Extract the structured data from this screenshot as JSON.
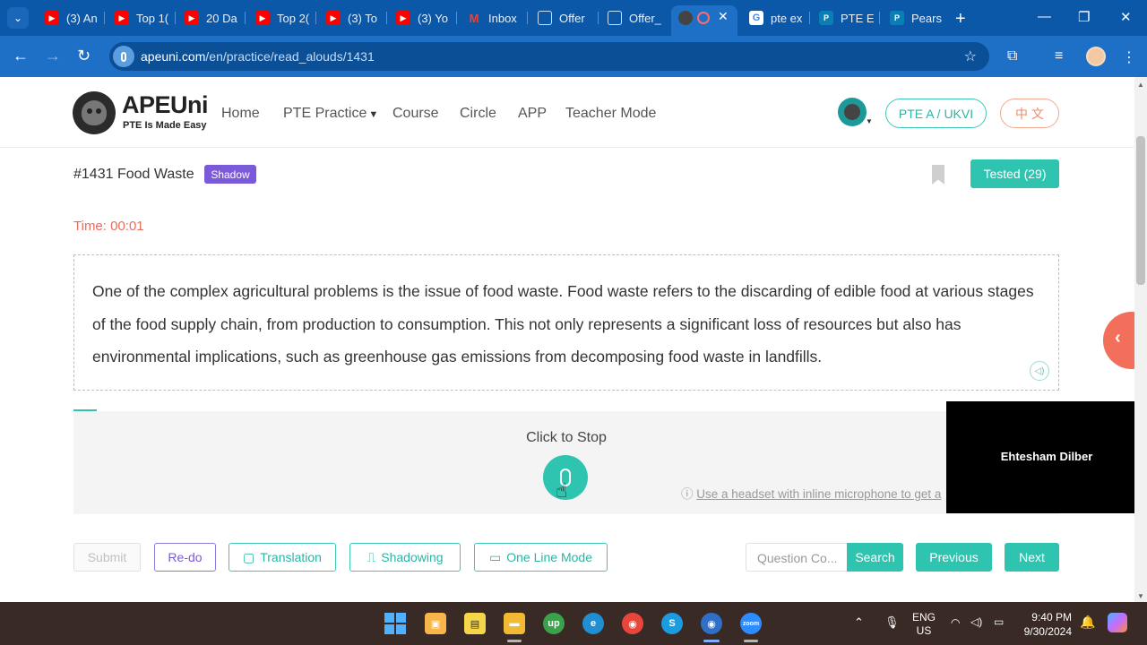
{
  "browser": {
    "tabs": [
      {
        "label": "(3) An",
        "icon": "youtube-icon"
      },
      {
        "label": "Top 1(",
        "icon": "youtube-icon"
      },
      {
        "label": "20 Da",
        "icon": "youtube-icon"
      },
      {
        "label": "Top 2(",
        "icon": "youtube-icon"
      },
      {
        "label": "(3) To",
        "icon": "youtube-icon"
      },
      {
        "label": "(3) Yo",
        "icon": "youtube-icon"
      },
      {
        "label": "Inbox",
        "icon": "gmail-icon"
      },
      {
        "label": "Offer",
        "icon": "globe-icon"
      },
      {
        "label": "Offer_",
        "icon": "globe-icon"
      },
      {
        "label": "",
        "icon": "apeuni-icon",
        "active": true
      },
      {
        "label": "pte ex",
        "icon": "google-icon"
      },
      {
        "label": "PTE E",
        "icon": "pearson-icon"
      },
      {
        "label": "Pears",
        "icon": "pearson-icon"
      }
    ],
    "url_host": "apeuni.com",
    "url_path": "/en/practice/read_alouds/1431"
  },
  "site": {
    "logo_title": "APEUni",
    "logo_subtitle": "PTE Is Made Easy",
    "nav": {
      "home": "Home",
      "pte_practice": "PTE Practice",
      "course": "Course",
      "circle": "Circle",
      "app": "APP",
      "teacher_mode": "Teacher Mode"
    },
    "exam_type": "PTE A / UKVI",
    "language": "中 文"
  },
  "question": {
    "title": "#1431 Food Waste",
    "badge": "Shadow",
    "tested": "Tested (29)",
    "timer": "Time: 00:01",
    "passage": "One of the complex agricultural problems is the issue of food waste. Food waste refers to the discarding of edible food at various stages of the food supply chain, from production to consumption. This not only represents a significant loss of resources but also has environmental implications, such as greenhouse gas emissions from decomposing food waste in landfills."
  },
  "recorder": {
    "label": "Click to Stop",
    "tip_prefix": "ⓘ",
    "tip_link": "Use a headset with inline microphone to get a"
  },
  "video_overlay": {
    "name": "Ehtesham Dilber"
  },
  "actions": {
    "submit": "Submit",
    "redo": "Re-do",
    "translation": "Translation",
    "shadowing": "Shadowing",
    "one_line_mode": "One Line Mode",
    "search_placeholder": "Question Co...",
    "search": "Search",
    "previous": "Previous",
    "next": "Next"
  },
  "taskbar": {
    "language": "ENG",
    "region": "US",
    "time": "9:40 PM",
    "date": "9/30/2024"
  },
  "colors": {
    "accent_teal": "#2ec4b0",
    "shadow_badge": "#7a5ad8",
    "timer": "#e96d5d",
    "browser_blue": "#1e70c6"
  }
}
